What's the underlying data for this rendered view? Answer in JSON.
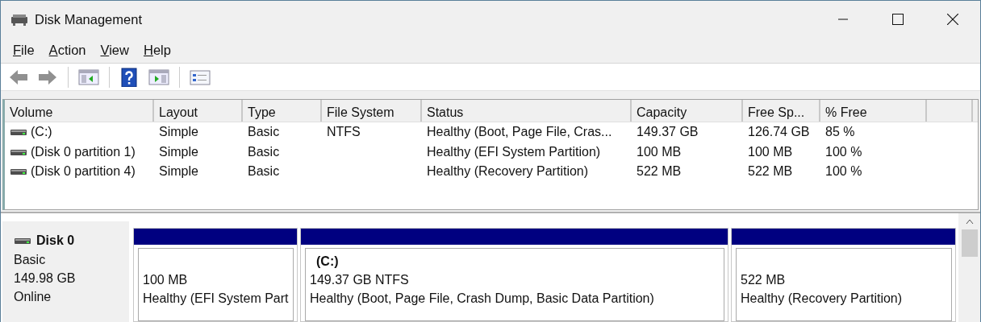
{
  "window": {
    "title": "Disk Management"
  },
  "menu": [
    {
      "label": "File"
    },
    {
      "label": "Action"
    },
    {
      "label": "View"
    },
    {
      "label": "Help"
    }
  ],
  "toolbar": [
    {
      "kind": "back",
      "disabled": true
    },
    {
      "kind": "forward",
      "disabled": true
    },
    {
      "kind": "separator"
    },
    {
      "kind": "console-tree",
      "disabled": false
    },
    {
      "kind": "separator"
    },
    {
      "kind": "help",
      "disabled": false
    },
    {
      "kind": "action-pane",
      "disabled": false
    },
    {
      "kind": "separator"
    },
    {
      "kind": "properties",
      "disabled": false
    }
  ],
  "volume_table": {
    "columns": [
      "Volume",
      "Layout",
      "Type",
      "File System",
      "Status",
      "Capacity",
      "Free Sp...",
      "% Free"
    ],
    "rows": [
      [
        "(C:)",
        "Simple",
        "Basic",
        "NTFS",
        "Healthy (Boot, Page File, Cras...",
        "149.37 GB",
        "126.74 GB",
        "85 %"
      ],
      [
        "(Disk 0 partition 1)",
        "Simple",
        "Basic",
        "",
        "Healthy (EFI System Partition)",
        "100 MB",
        "100 MB",
        "100 %"
      ],
      [
        "(Disk 0 partition 4)",
        "Simple",
        "Basic",
        "",
        "Healthy (Recovery Partition)",
        "522 MB",
        "522 MB",
        "100 %"
      ]
    ]
  },
  "disks": [
    {
      "name": "Disk 0",
      "type": "Basic",
      "size": "149.98 GB",
      "state": "Online",
      "partitions": [
        {
          "size": "100 MB",
          "status": "Healthy (EFI System Part",
          "color": "#000080"
        },
        {
          "label": "(C:)",
          "size": "149.37 GB NTFS",
          "status": "Healthy (Boot, Page File, Crash Dump, Basic Data Partition)",
          "color": "#000080"
        },
        {
          "size": "522 MB",
          "status": "Healthy (Recovery Partition)",
          "color": "#000080"
        }
      ]
    }
  ]
}
